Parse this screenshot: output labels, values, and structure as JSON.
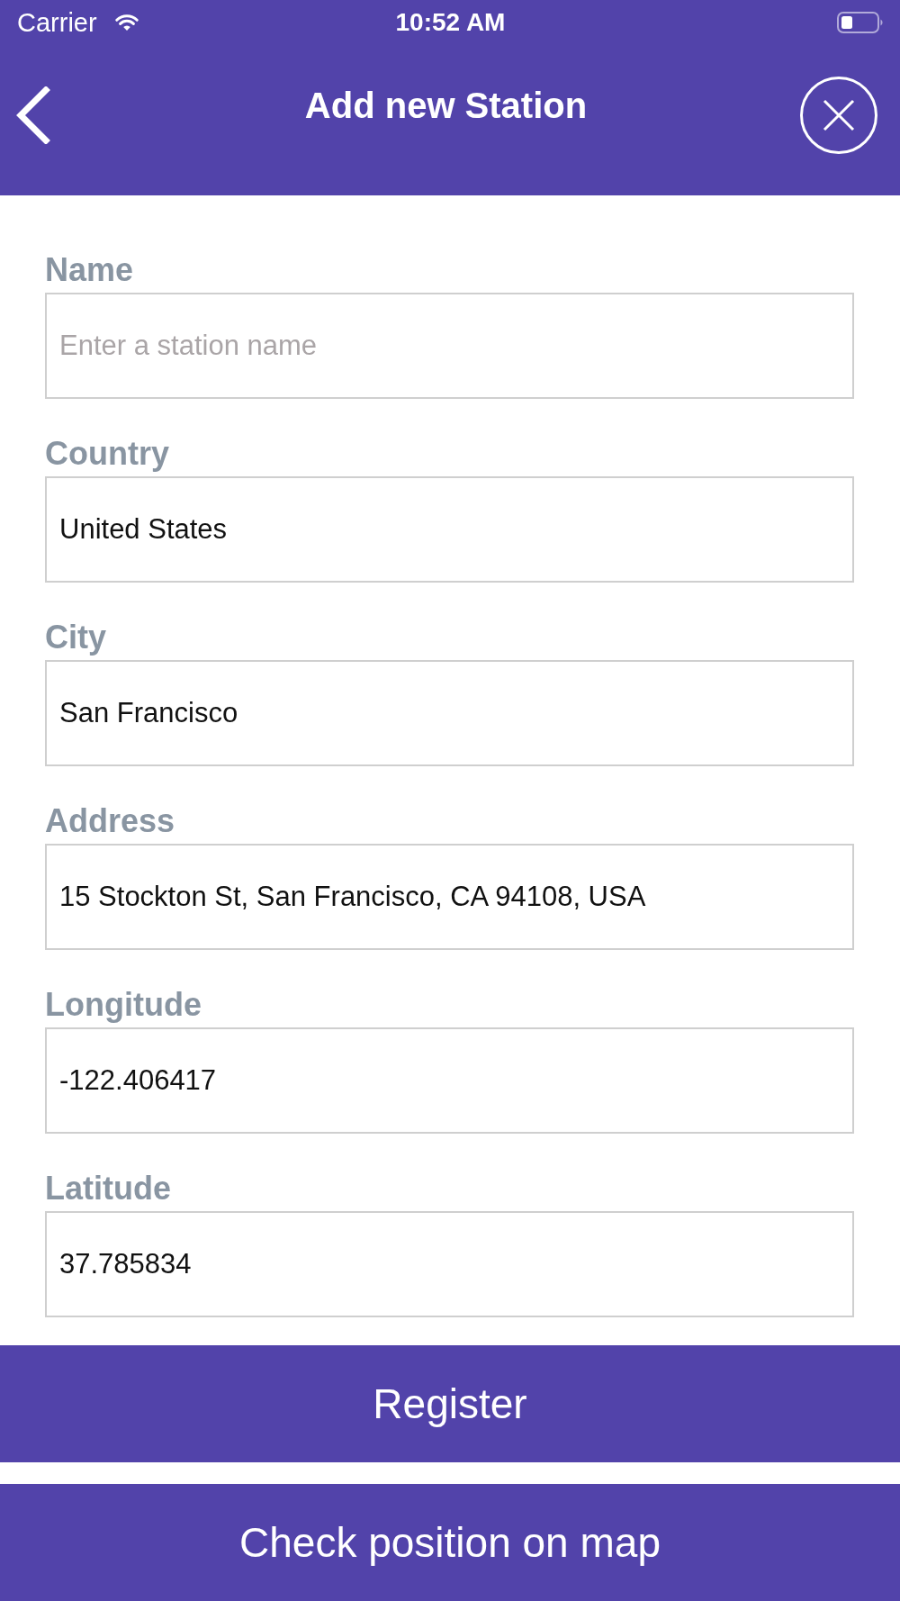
{
  "status_bar": {
    "carrier": "Carrier",
    "time": "10:52 AM"
  },
  "header": {
    "title": "Add new Station"
  },
  "fields": [
    {
      "label": "Name",
      "placeholder": "Enter a station name"
    },
    {
      "label": "Country",
      "value": "United States"
    },
    {
      "label": "City",
      "value": "San Francisco"
    },
    {
      "label": "Address",
      "value": "15 Stockton St, San Francisco, CA 94108, USA"
    },
    {
      "label": "Longitude",
      "value": "-122.406417"
    },
    {
      "label": "Latitude",
      "value": "37.785834"
    }
  ],
  "buttons": [
    {
      "label": "Register"
    },
    {
      "label": "Check position on map"
    }
  ]
}
